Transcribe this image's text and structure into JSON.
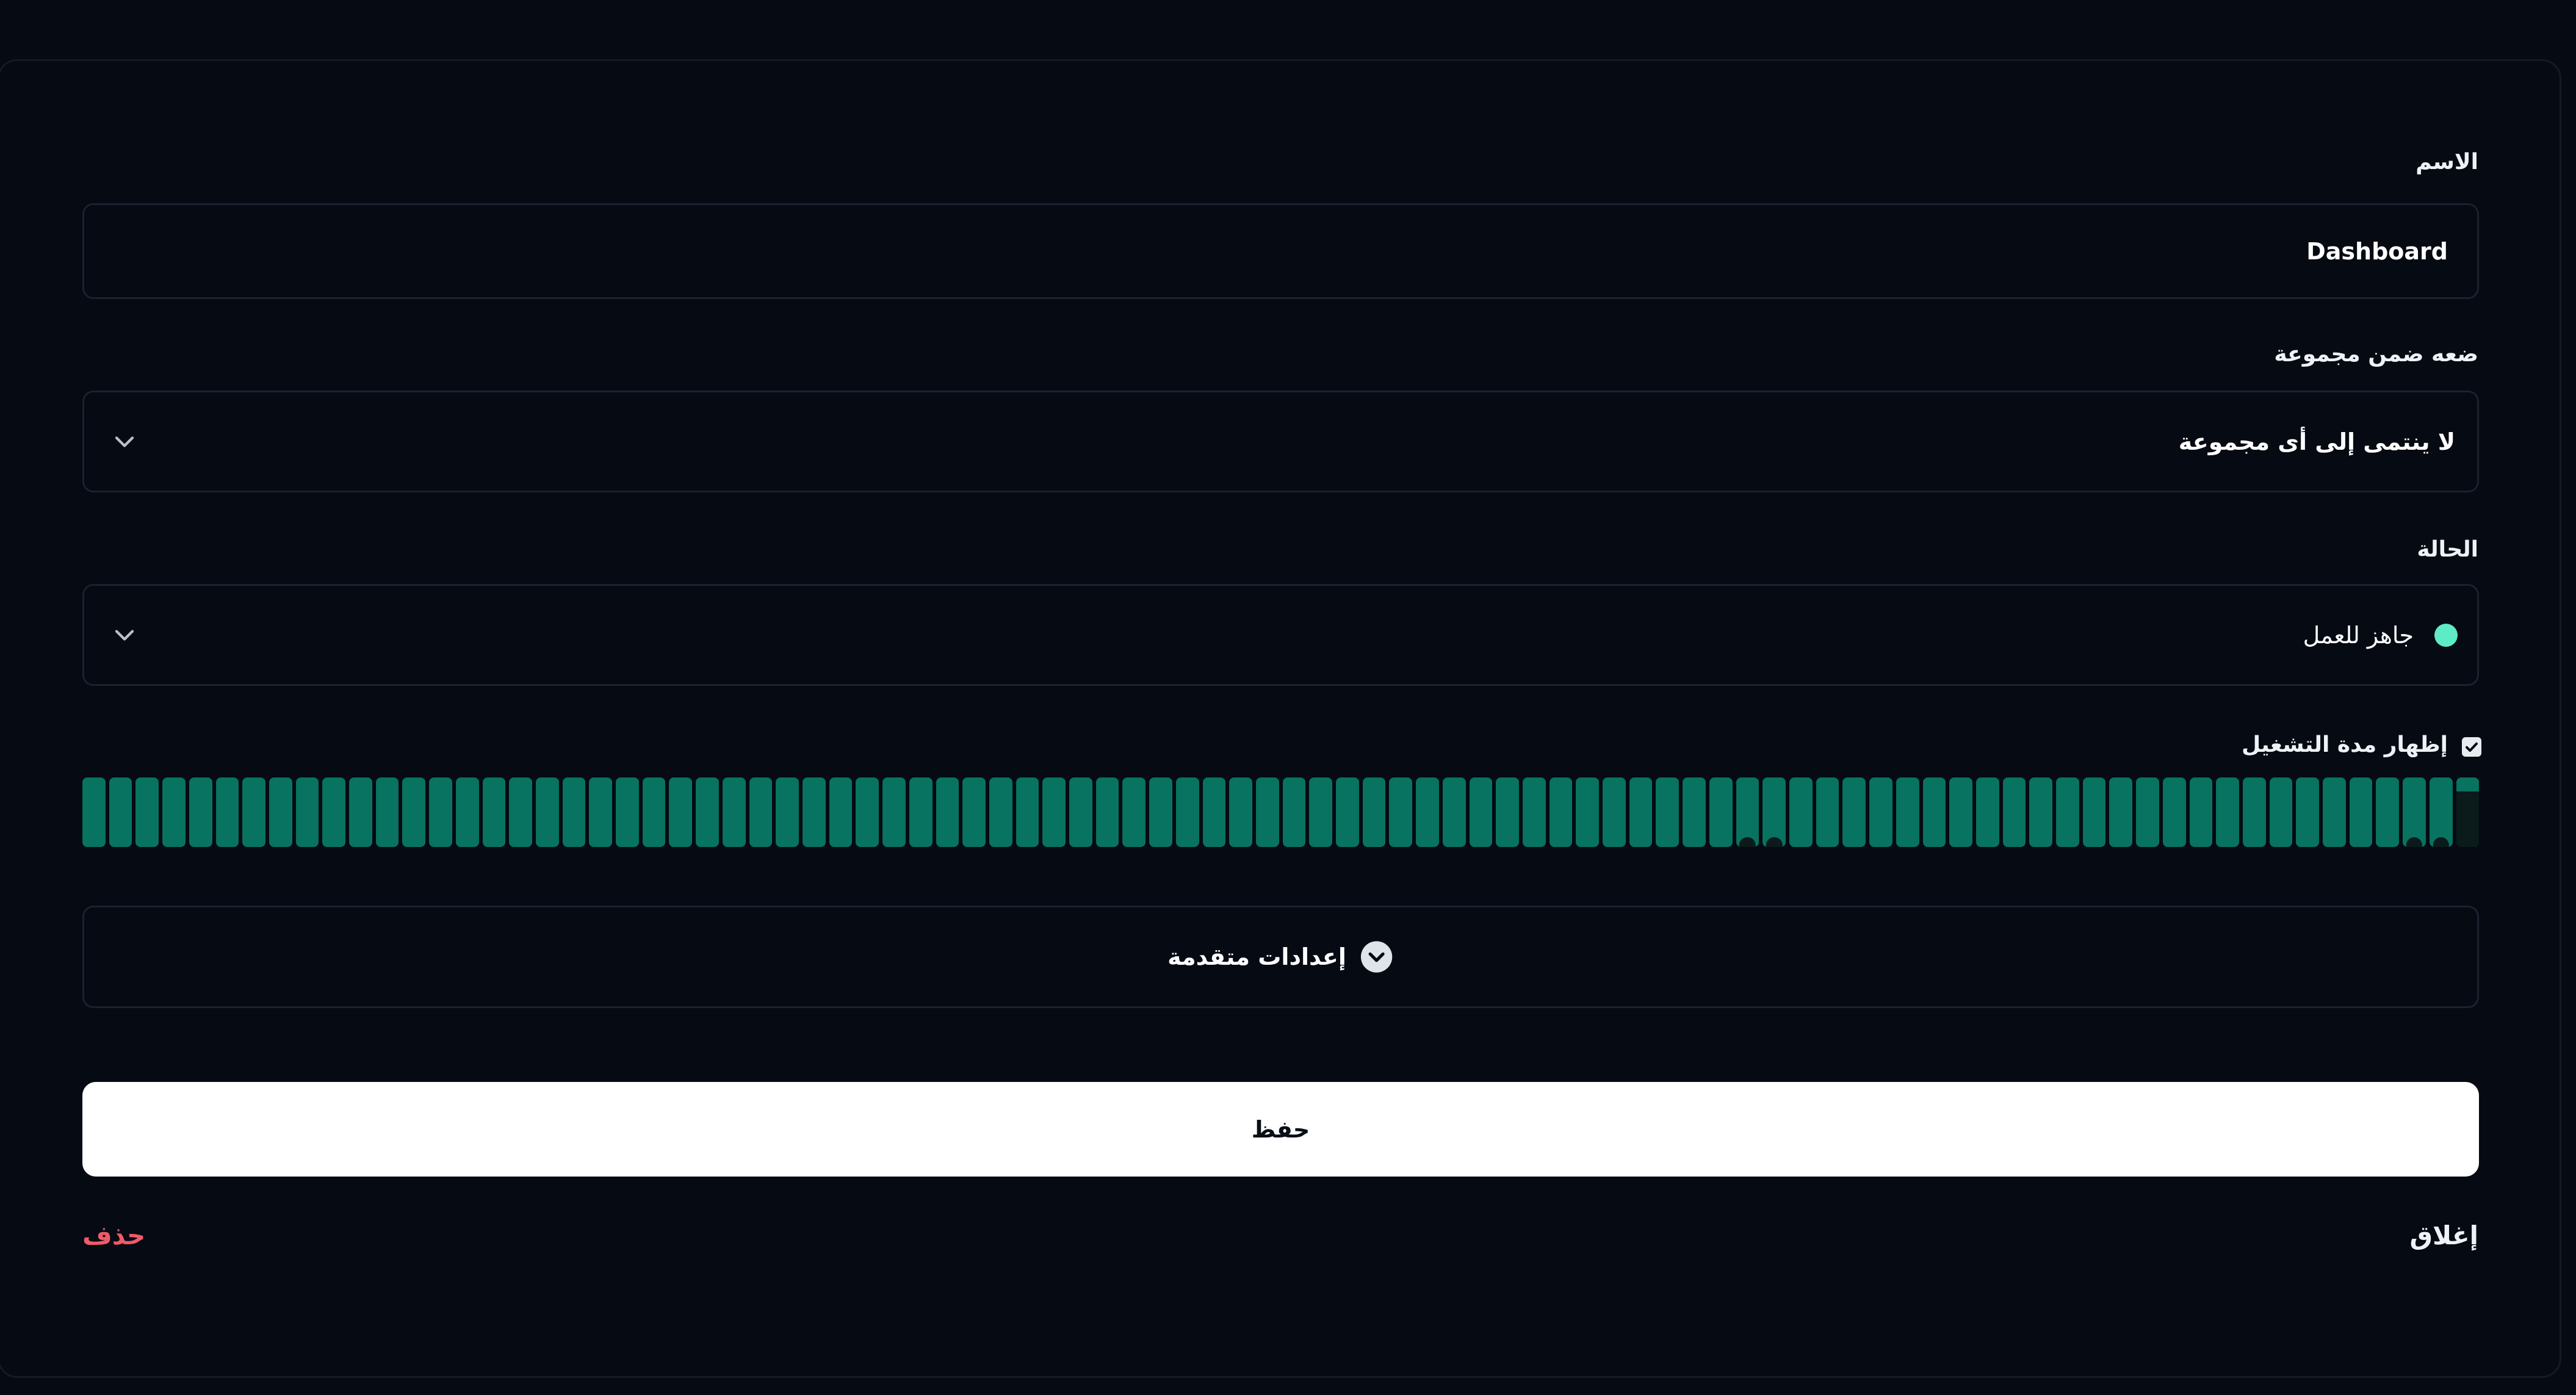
{
  "form": {
    "name": {
      "label": "الاسم",
      "value": "Dashboard"
    },
    "group": {
      "label": "ضعه ضمن مجموعة",
      "selected": "لا ينتمى إلى أى مجموعة"
    },
    "status": {
      "label": "الحالة",
      "selected": "جاهز للعمل",
      "dot_color": "#5eecc6"
    },
    "uptime": {
      "checkbox_label": "إظهار مدة التشغيل",
      "checked": true,
      "bar_color": "#077360"
    },
    "advanced": {
      "label": "إعدادات متقدمة"
    },
    "save_label": "حفظ",
    "close_label": "إغلاق",
    "delete_label": "حذف",
    "delete_color": "#f05a67"
  },
  "icons": {
    "group_dropdown": "chevron-down-icon",
    "status_dropdown": "chevron-down-icon",
    "advanced": "chevron-circle-down-icon",
    "checkbox": "check-icon"
  }
}
